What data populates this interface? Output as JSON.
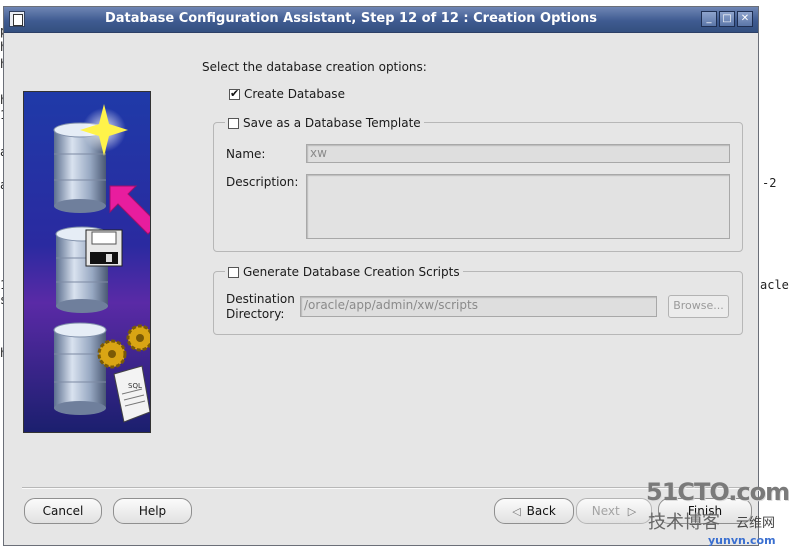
{
  "background_terminal": {
    "lines": [
      "p",
      "h",
      "h",
      "h",
      "1",
      "a",
      "a",
      "1",
      "s",
      "h"
    ],
    "right_fragments": [
      "-2",
      "acle"
    ]
  },
  "window": {
    "title": "Database Configuration Assistant, Step 12 of 12 : Creation Options",
    "controls": {
      "minimize": "_",
      "maximize": "□",
      "close": "✕"
    }
  },
  "instruction": "Select the database creation options:",
  "options": {
    "create_database": {
      "label": "Create Database",
      "checked": true
    },
    "save_template": {
      "label": "Save as a Database Template",
      "checked": false
    },
    "template_name_label": "Name:",
    "template_name_value": "xw",
    "template_description_label": "Description:",
    "template_description_value": "",
    "generate_scripts": {
      "label": "Generate Database Creation Scripts",
      "checked": false
    },
    "destination_label_1": "Destination",
    "destination_label_2": "Directory:",
    "destination_value": "/oracle/app/admin/xw/scripts",
    "browse_label": "Browse..."
  },
  "footer": {
    "cancel": "Cancel",
    "help": "Help",
    "back": "Back",
    "next": "Next",
    "finish": "Finish"
  },
  "watermark": {
    "site1": "51CTO.com",
    "site2": "技术博客",
    "site3": "yunvn.com",
    "site4": "云维网"
  }
}
